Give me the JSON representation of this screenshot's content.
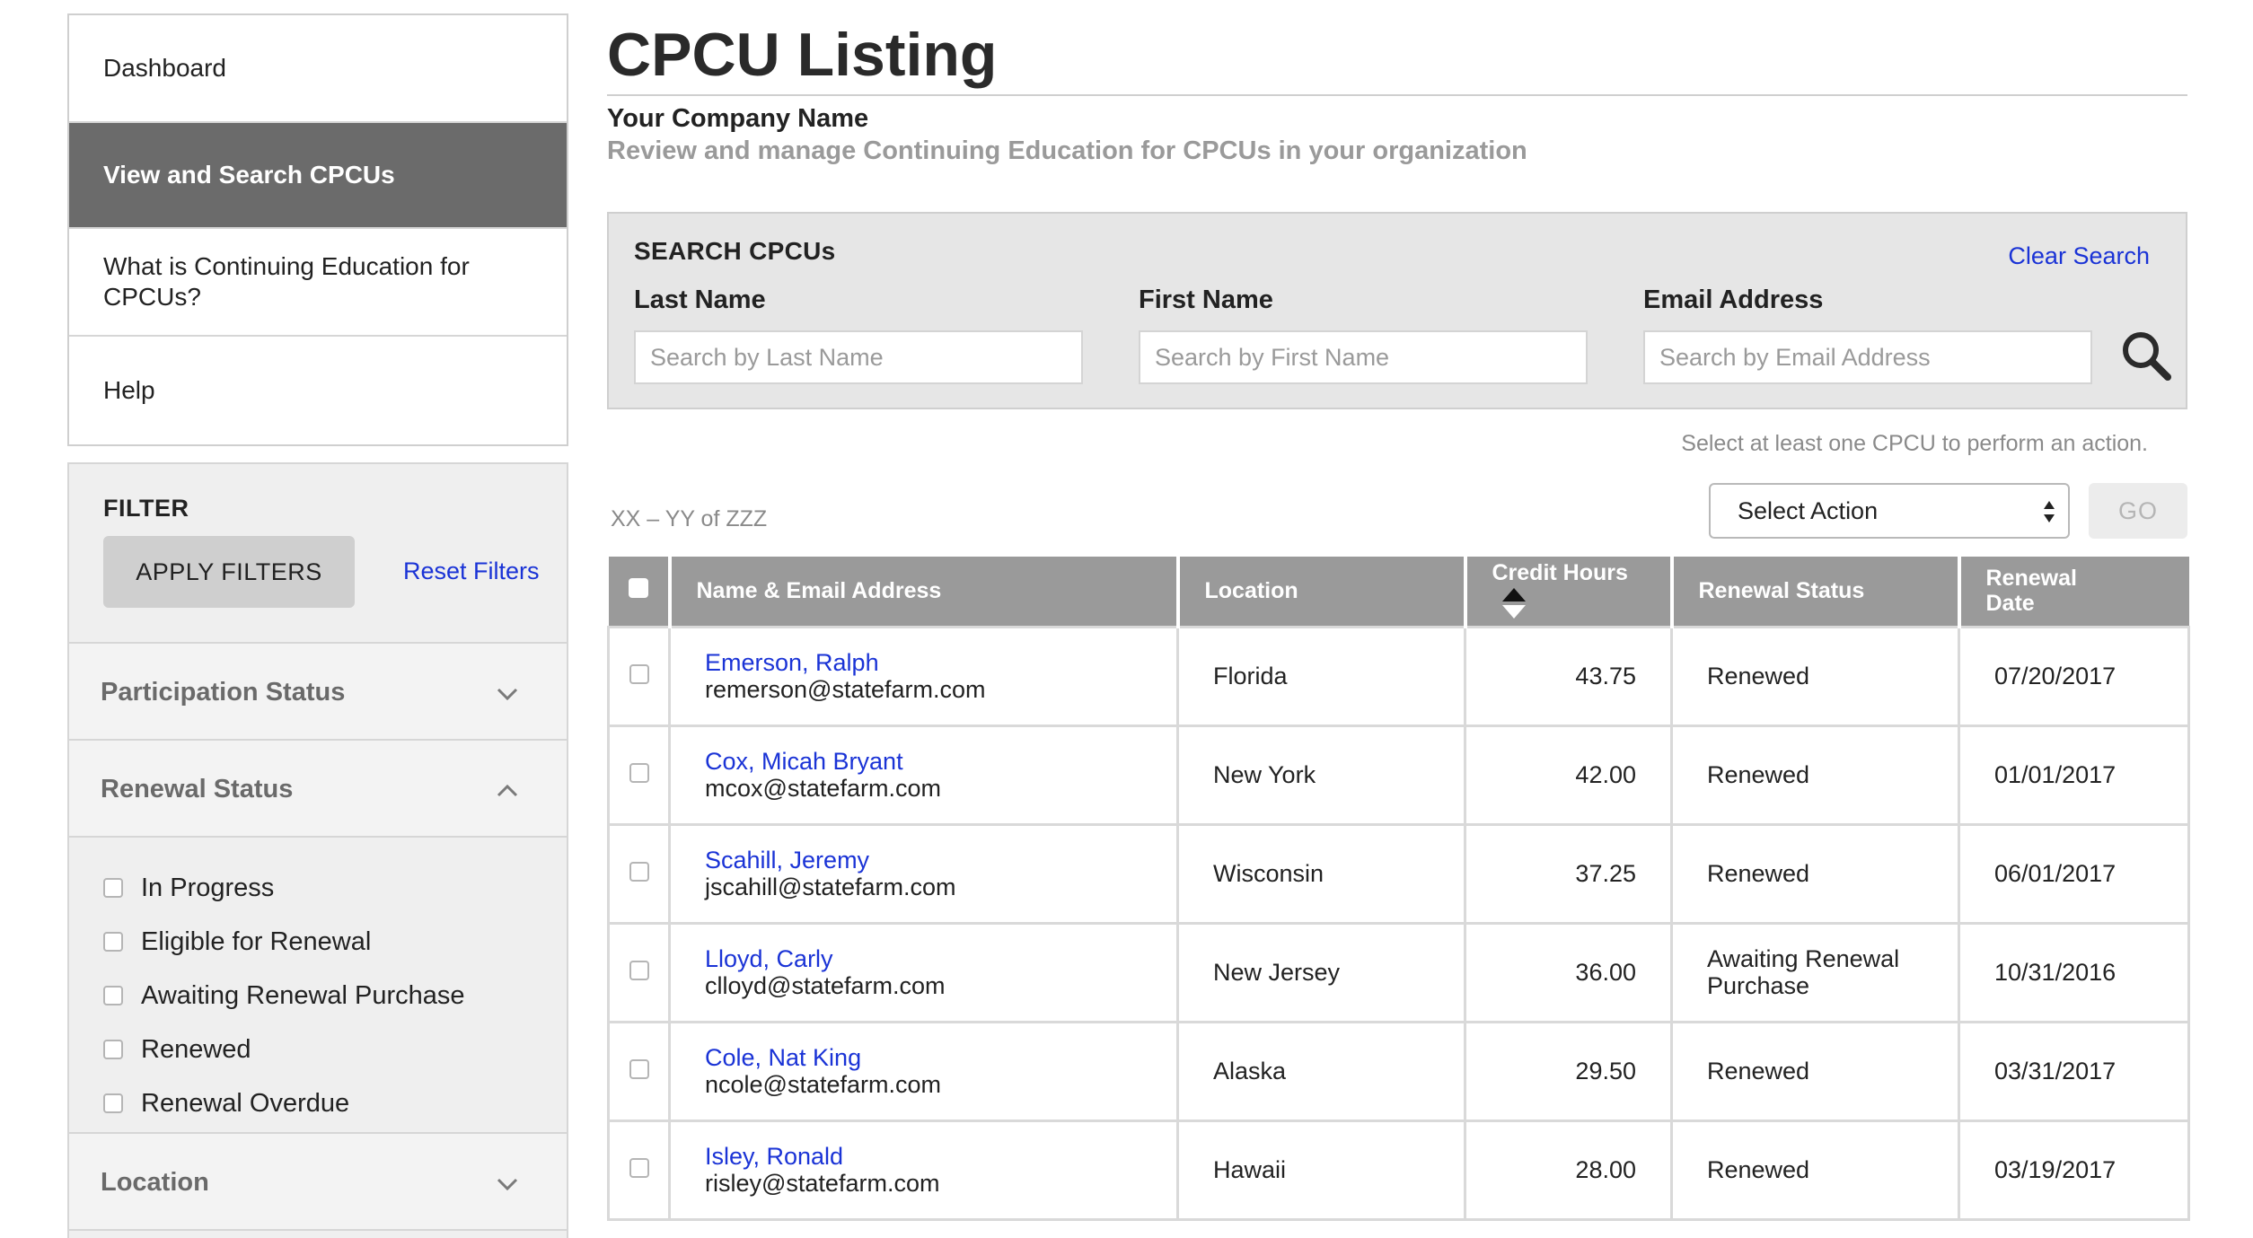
{
  "nav": {
    "items": [
      {
        "label": "Dashboard"
      },
      {
        "label": "View and Search CPCUs",
        "active": true
      },
      {
        "label": "What is Continuing Education for CPCUs?"
      },
      {
        "label": "Help"
      }
    ]
  },
  "filter": {
    "title": "FILTER",
    "apply_label": "APPLY FILTERS",
    "reset_label": "Reset Filters",
    "sections": [
      {
        "label": "Participation Status",
        "expanded": false
      },
      {
        "label": "Renewal Status",
        "expanded": true
      },
      {
        "label": "Location",
        "expanded": false
      }
    ],
    "renewal_options": [
      {
        "label": "In Progress",
        "checked": false
      },
      {
        "label": "Eligible for Renewal",
        "checked": false
      },
      {
        "label": "Awaiting Renewal Purchase",
        "checked": false
      },
      {
        "label": "Renewed",
        "checked": false
      },
      {
        "label": "Renewal Overdue",
        "checked": false
      }
    ]
  },
  "header": {
    "title": "CPCU Listing",
    "company": "Your Company Name",
    "subtitle": "Review and manage Continuing Education for CPCUs in your organization"
  },
  "search": {
    "title": "SEARCH CPCUs",
    "clear_label": "Clear Search",
    "fields": [
      {
        "label": "Last Name",
        "placeholder": "Search by Last Name",
        "value": ""
      },
      {
        "label": "First Name",
        "placeholder": "Search by First Name",
        "value": ""
      },
      {
        "label": "Email Address",
        "placeholder": "Search by Email Address",
        "value": ""
      }
    ]
  },
  "actions": {
    "hint": "Select at least one CPCU to perform an action.",
    "range": "XX – YY of ZZZ",
    "select_label": "Select Action",
    "go_label": "GO"
  },
  "table": {
    "columns": [
      "Name & Email Address",
      "Location",
      "Credit Hours",
      "Renewal Status",
      "Renewal Date"
    ],
    "rows": [
      {
        "name": "Emerson, Ralph",
        "email": "remerson@statefarm.com",
        "location": "Florida",
        "hours": "43.75",
        "status": "Renewed",
        "date": "07/20/2017"
      },
      {
        "name": "Cox, Micah Bryant",
        "email": "mcox@statefarm.com",
        "location": "New York",
        "hours": "42.00",
        "status": "Renewed",
        "date": "01/01/2017"
      },
      {
        "name": "Scahill, Jeremy",
        "email": "jscahill@statefarm.com",
        "location": "Wisconsin",
        "hours": "37.25",
        "status": "Renewed",
        "date": "06/01/2017"
      },
      {
        "name": "Lloyd, Carly",
        "email": "clloyd@statefarm.com",
        "location": "New Jersey",
        "hours": "36.00",
        "status": "Awaiting Renewal Purchase",
        "date": "10/31/2016"
      },
      {
        "name": "Cole, Nat King",
        "email": "ncole@statefarm.com",
        "location": "Alaska",
        "hours": "29.50",
        "status": "Renewed",
        "date": "03/31/2017"
      },
      {
        "name": "Isley, Ronald",
        "email": "risley@statefarm.com",
        "location": "Hawaii",
        "hours": "28.00",
        "status": "Renewed",
        "date": "03/19/2017"
      }
    ]
  },
  "colors": {
    "link": "#1a33d6",
    "nav_active": "#6b6b6b",
    "table_header": "#9a9a9a"
  }
}
